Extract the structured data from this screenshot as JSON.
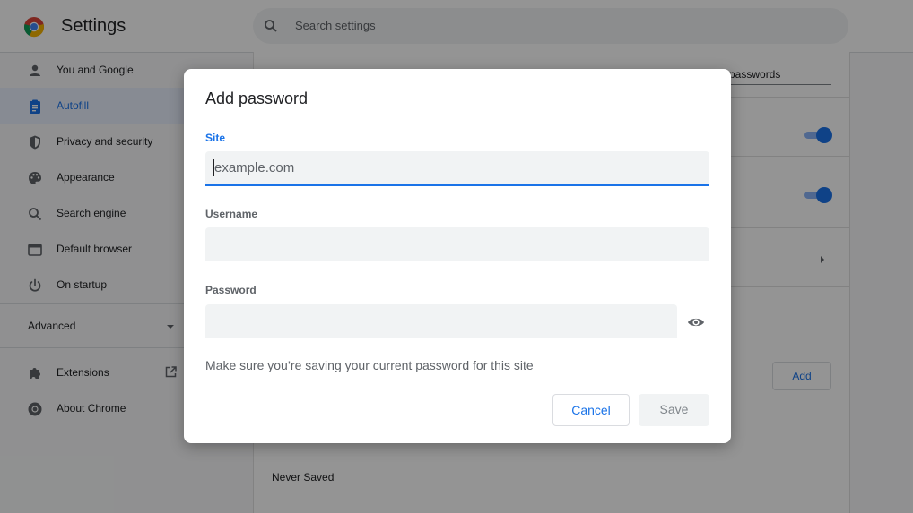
{
  "app": {
    "title": "Settings"
  },
  "search": {
    "placeholder": "Search settings"
  },
  "sidebar": {
    "items": [
      {
        "label": "You and Google",
        "icon": "person-icon"
      },
      {
        "label": "Autofill",
        "icon": "clipboard-icon"
      },
      {
        "label": "Privacy and security",
        "icon": "shield-icon"
      },
      {
        "label": "Appearance",
        "icon": "palette-icon"
      },
      {
        "label": "Search engine",
        "icon": "search-icon"
      },
      {
        "label": "Default browser",
        "icon": "browser-window-icon"
      },
      {
        "label": "On startup",
        "icon": "power-icon"
      }
    ],
    "active": "Autofill",
    "advanced_label": "Advanced",
    "extra_items": [
      {
        "label": "Extensions",
        "icon": "puzzle-icon"
      },
      {
        "label": "About Chrome",
        "icon": "chrome-icon"
      }
    ]
  },
  "background": {
    "search_text": "passwords",
    "add_label": "Add",
    "never_saved_label": "Never Saved"
  },
  "dialog": {
    "title": "Add password",
    "site_label": "Site",
    "site_placeholder": "example.com",
    "username_label": "Username",
    "password_label": "Password",
    "note": "Make sure you’re saving your current password for this site",
    "cancel_label": "Cancel",
    "save_label": "Save"
  },
  "colors": {
    "accent": "#1a73e8",
    "overlay": "rgba(0,0,0,0.42)"
  }
}
